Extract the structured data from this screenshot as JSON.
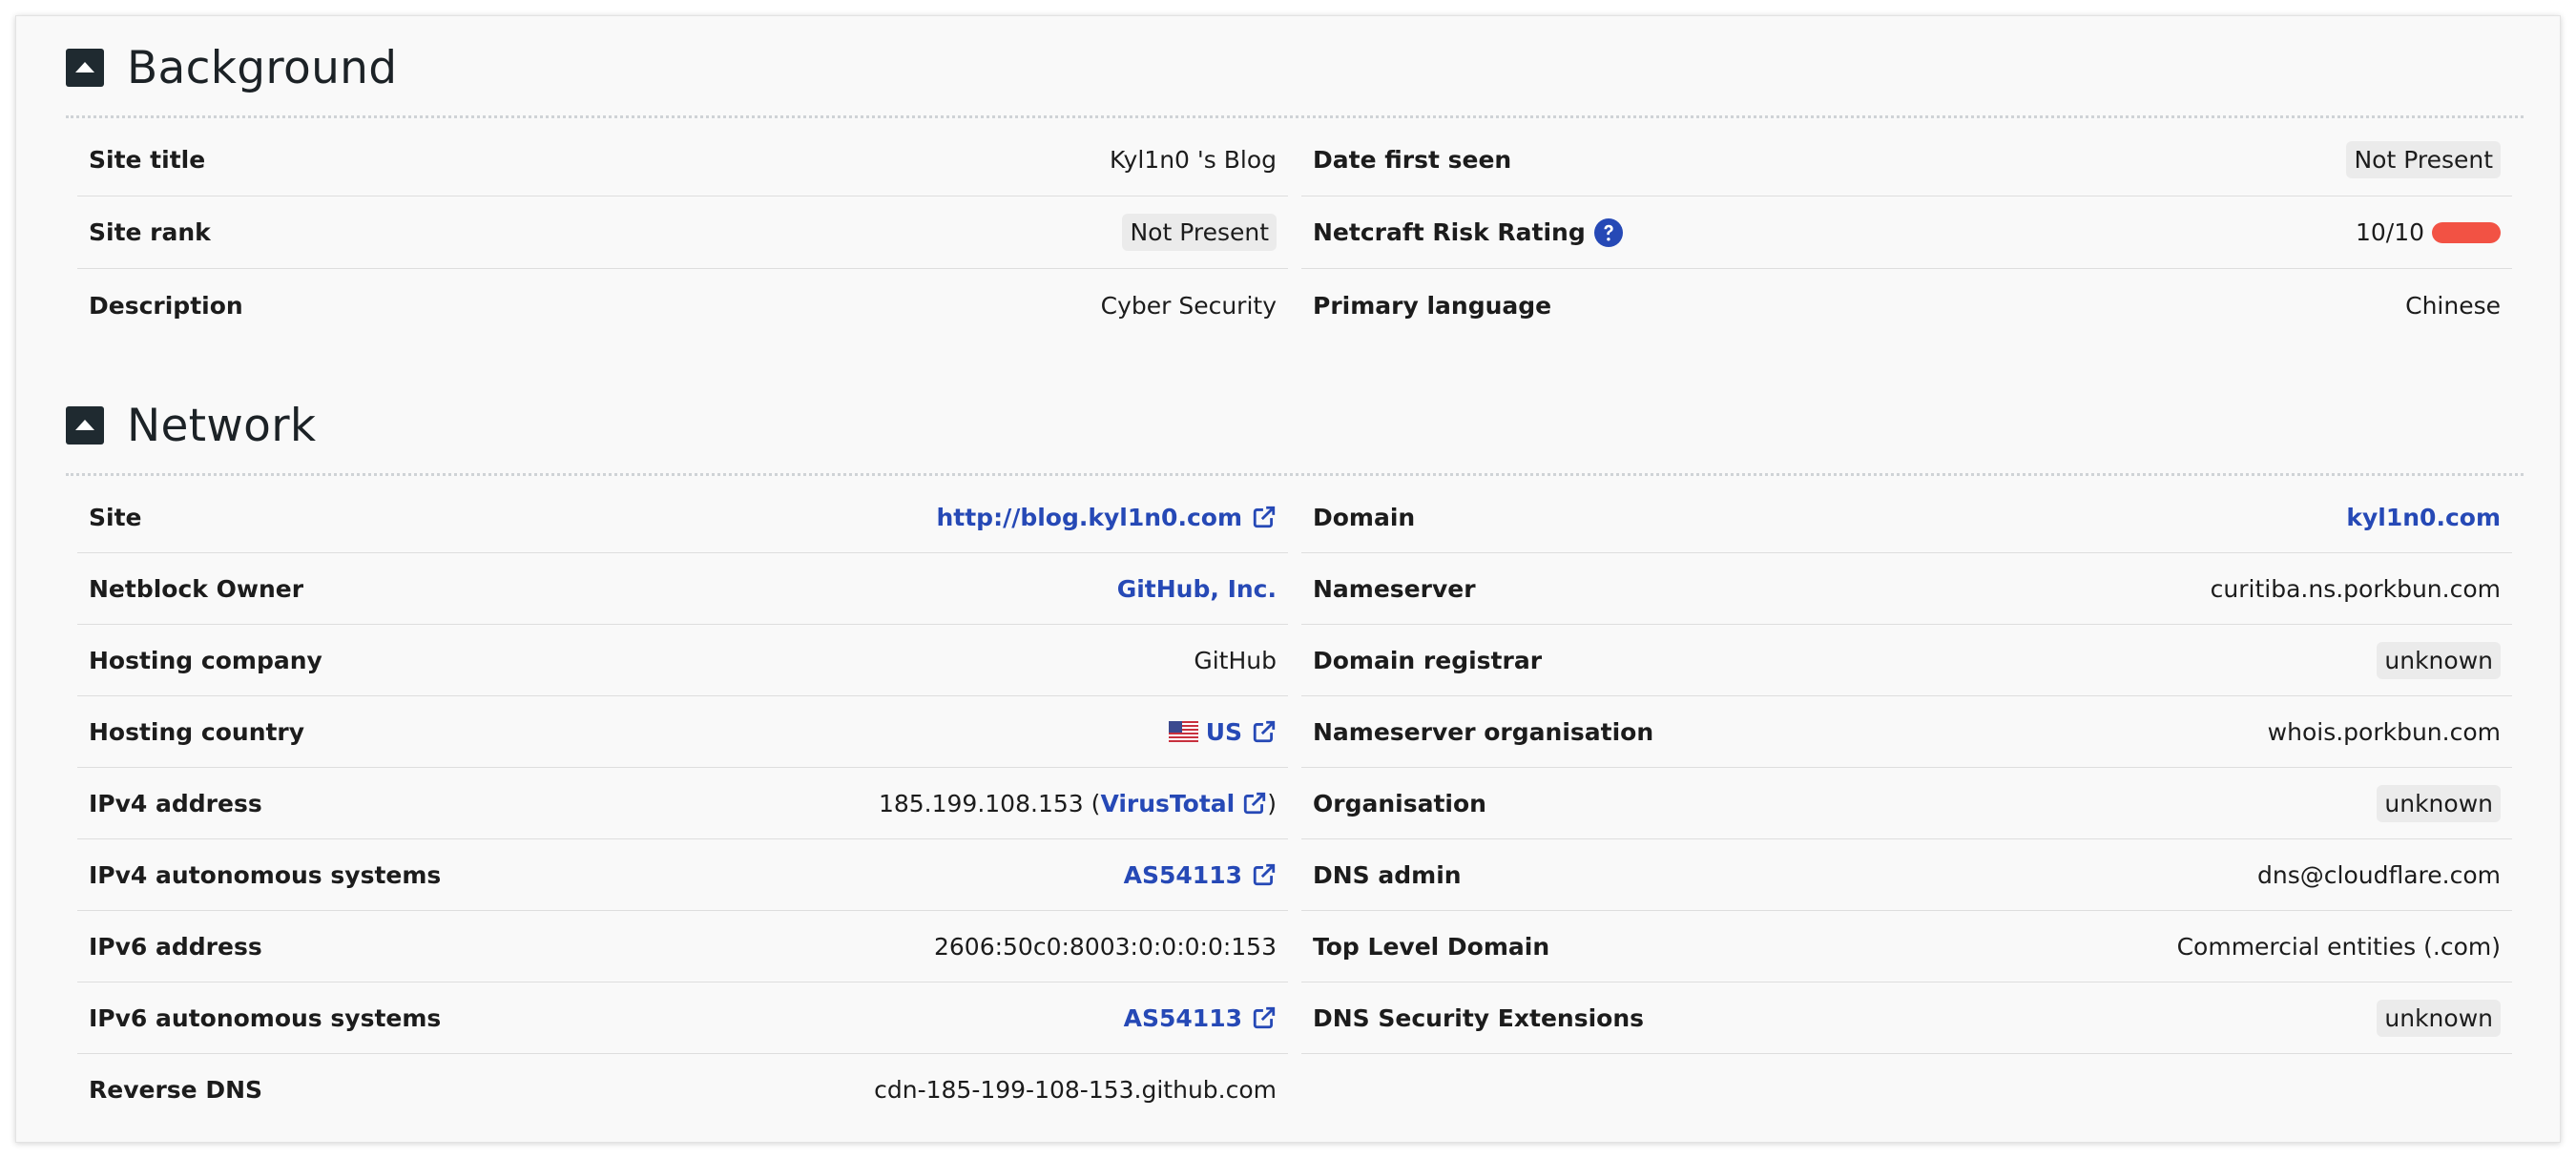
{
  "background": {
    "title": "Background",
    "left": [
      {
        "label": "Site title",
        "value": "Kyl1n0 's Blog"
      },
      {
        "label": "Site rank",
        "value": "Not Present"
      },
      {
        "label": "Description",
        "value": "Cyber Security"
      }
    ],
    "right": [
      {
        "label": "Date first seen",
        "value": "Not Present"
      },
      {
        "label": "Netcraft Risk Rating",
        "value": "10/10",
        "risk_level": 1.0
      },
      {
        "label": "Primary language",
        "value": "Chinese"
      }
    ]
  },
  "network": {
    "title": "Network",
    "left": [
      {
        "label": "Site",
        "value": "http://blog.kyl1n0.com"
      },
      {
        "label": "Netblock Owner",
        "value": "GitHub, Inc."
      },
      {
        "label": "Hosting company",
        "value": "GitHub"
      },
      {
        "label": "Hosting country",
        "value": "US"
      },
      {
        "label": "IPv4 address",
        "value": "185.199.108.153",
        "paren_open": "(",
        "link": "VirusTotal",
        "paren_close": ")"
      },
      {
        "label": "IPv4 autonomous systems",
        "value": "AS54113"
      },
      {
        "label": "IPv6 address",
        "value": "2606:50c0:8003:0:0:0:0:153"
      },
      {
        "label": "IPv6 autonomous systems",
        "value": "AS54113"
      },
      {
        "label": "Reverse DNS",
        "value": "cdn-185-199-108-153.github.com"
      }
    ],
    "right": [
      {
        "label": "Domain",
        "value": "kyl1n0.com"
      },
      {
        "label": "Nameserver",
        "value": "curitiba.ns.porkbun.com"
      },
      {
        "label": "Domain registrar",
        "value": "unknown"
      },
      {
        "label": "Nameserver organisation",
        "value": "whois.porkbun.com"
      },
      {
        "label": "Organisation",
        "value": "unknown"
      },
      {
        "label": "DNS admin",
        "value": "dns@cloudflare.com"
      },
      {
        "label": "Top Level Domain",
        "value": "Commercial entities (.com)"
      },
      {
        "label": "DNS Security Extensions",
        "value": "unknown"
      }
    ]
  },
  "colors": {
    "link": "#2649b6",
    "risk_high": "#f25244",
    "toggle": "#1f2a30",
    "help_icon": "#2649b6"
  },
  "icons": {
    "section_toggle": "caret-up-square-icon",
    "external_link": "external-link-icon",
    "help": "question-circle-icon",
    "flag": "us-flag-icon"
  }
}
